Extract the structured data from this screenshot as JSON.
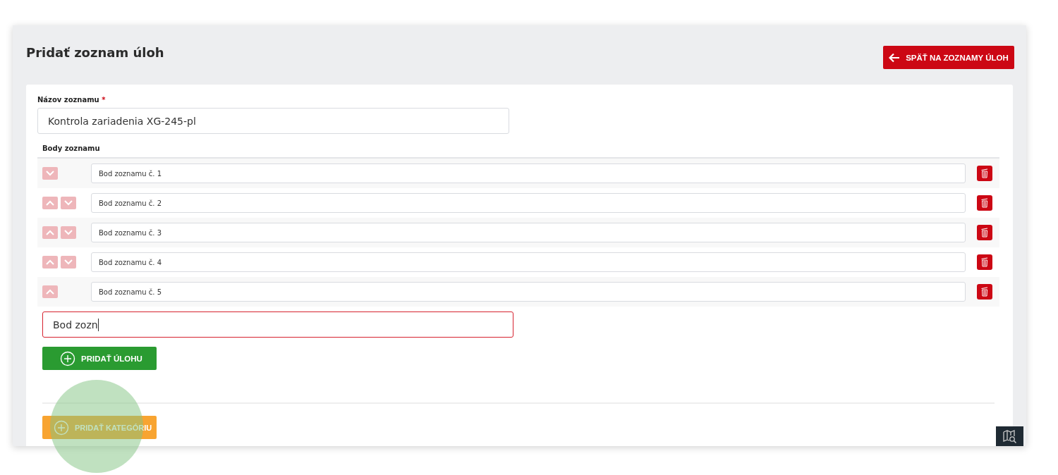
{
  "page": {
    "title": "Pridať zoznam úloh",
    "back_button": "SPÄŤ NA ZOZNAMY ÚLOH"
  },
  "list_name": {
    "label": "Názov zoznamu",
    "required_mark": "*",
    "value": "Kontrola zariadenia XG-245-pl"
  },
  "items_heading": "Body zoznamu",
  "items": [
    {
      "value": "Bod zoznamu č. 1",
      "move_up": false,
      "move_down": true
    },
    {
      "value": "Bod zoznamu č. 2",
      "move_up": true,
      "move_down": true
    },
    {
      "value": "Bod zoznamu č. 3",
      "move_up": true,
      "move_down": true
    },
    {
      "value": "Bod zoznamu č. 4",
      "move_up": true,
      "move_down": true
    },
    {
      "value": "Bod zoznamu č. 5",
      "move_up": true,
      "move_down": false
    }
  ],
  "new_item": {
    "value": "Bod zozn",
    "invalid": true
  },
  "add_task_button": "PRIDAŤ ÚLOHU",
  "add_category_button": "PRIDAŤ KATEGÓRIU"
}
